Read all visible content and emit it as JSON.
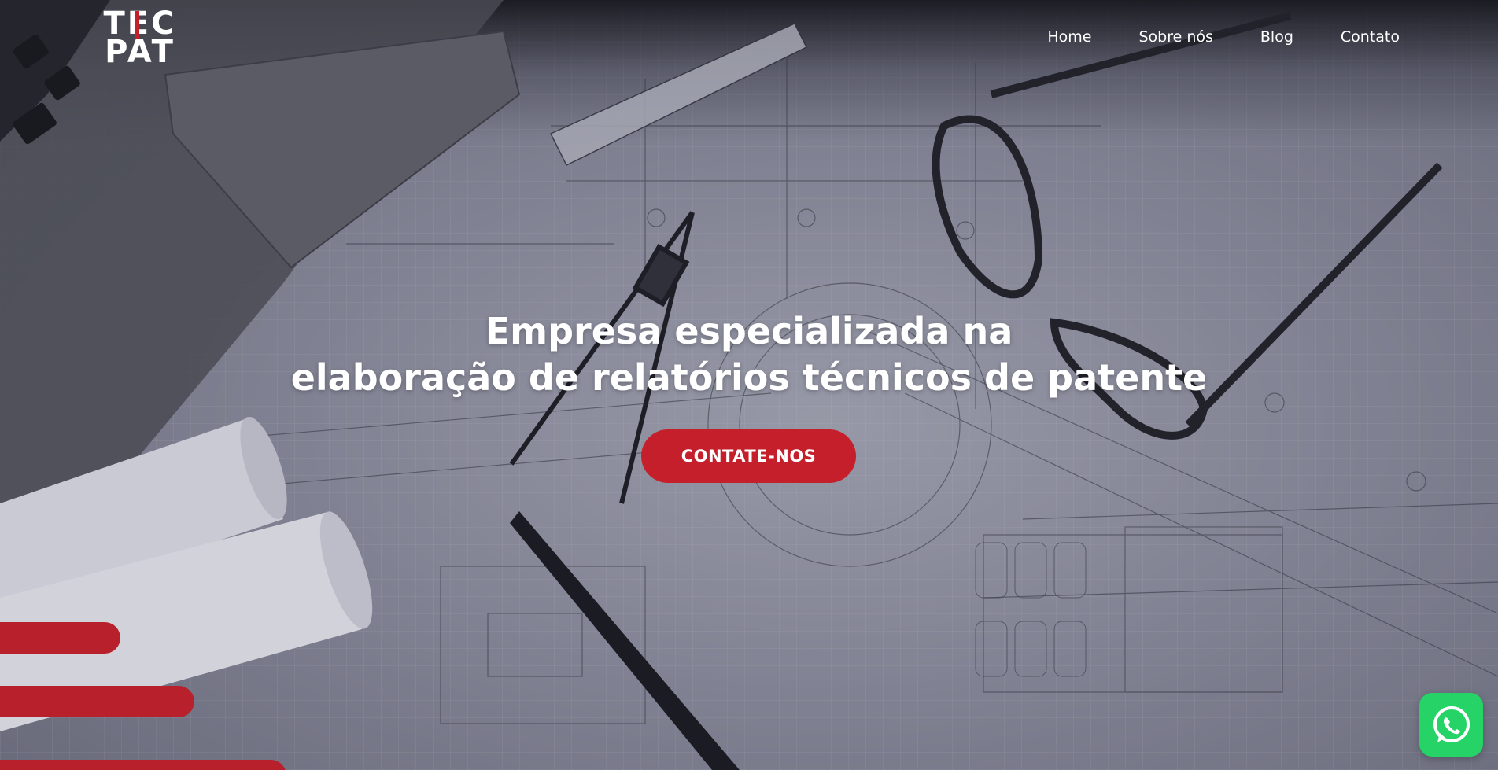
{
  "brand": {
    "logo_line1": "TEC",
    "logo_line2": "PAT",
    "accent_color": "#c41f2a"
  },
  "nav": {
    "items": [
      {
        "label": "Home"
      },
      {
        "label": "Sobre nós"
      },
      {
        "label": "Blog"
      },
      {
        "label": "Contato"
      }
    ]
  },
  "hero": {
    "title_line1": "Empresa especializada na",
    "title_line2": "elaboração de relatórios técnicos de patente",
    "cta_label": "CONTATE-NOS",
    "background": "blueprint-photo"
  },
  "floating": {
    "whatsapp_icon": "whatsapp-icon",
    "whatsapp_color": "#25d366"
  },
  "decor": {
    "bar_color": "#b8202b"
  }
}
